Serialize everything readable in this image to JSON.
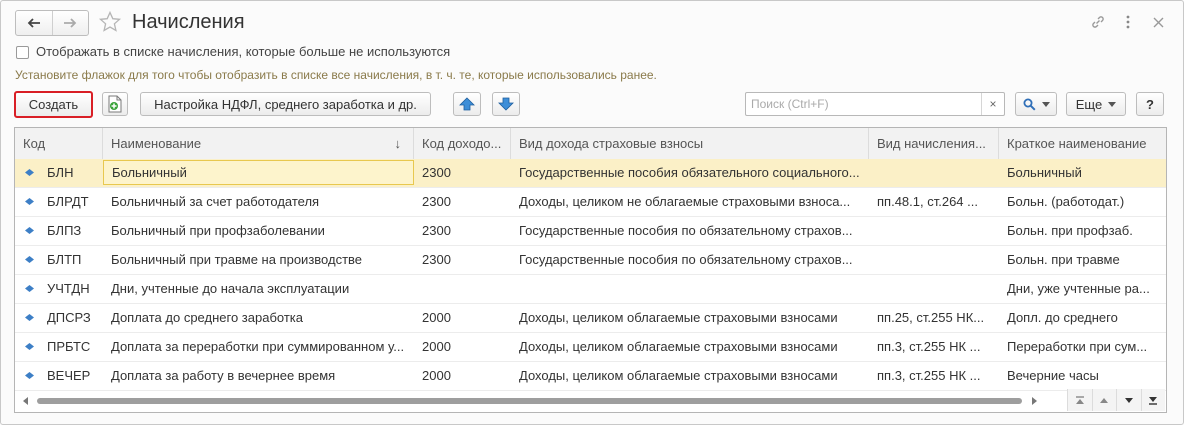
{
  "window": {
    "title": "Начисления"
  },
  "filter": {
    "checkbox_label": "Отображать в списке начисления, которые больше не используются",
    "hint": "Установите флажок для того чтобы отобразить в списке все начисления, в т. ч. те, которые использовались ранее."
  },
  "toolbar": {
    "create_label": "Создать",
    "settings_label": "Настройка НДФЛ, среднего заработка и др.",
    "search_placeholder": "Поиск (Ctrl+F)",
    "search_clear": "×",
    "more_label": "Еще",
    "help_label": "?"
  },
  "table": {
    "columns": [
      "Код",
      "Наименование",
      "Код доходо...",
      "Вид дохода страховые взносы",
      "Вид начисления...",
      "Краткое наименование"
    ],
    "sort_indicator": "↓",
    "rows": [
      [
        "БЛН",
        "Больничный",
        "2300",
        "Государственные пособия обязательного социального...",
        "",
        "Больничный"
      ],
      [
        "БЛРДТ",
        "Больничный за счет работодателя",
        "2300",
        "Доходы, целиком не облагаемые страховыми взноса...",
        "пп.48.1, ст.264 ...",
        "Больн. (работодат.)"
      ],
      [
        "БЛПЗ",
        "Больничный при профзаболевании",
        "2300",
        "Государственные пособия по обязательному страхов...",
        "",
        "Больн. при профзаб."
      ],
      [
        "БЛТП",
        "Больничный при травме на производстве",
        "2300",
        "Государственные пособия по обязательному страхов...",
        "",
        "Больн. при травме"
      ],
      [
        "УЧТДН",
        "Дни, учтенные до начала эксплуатации",
        "",
        "",
        "",
        "Дни, уже учтенные ра..."
      ],
      [
        "ДПСРЗ",
        "Доплата до среднего заработка",
        "2000",
        "Доходы, целиком облагаемые страховыми взносами",
        "пп.25, ст.255 НК...",
        "Допл. до среднего"
      ],
      [
        "ПРБТС",
        "Доплата за переработки при суммированном у...",
        "2000",
        "Доходы, целиком облагаемые страховыми взносами",
        "пп.3, ст.255 НК ...",
        "Переработки при сум..."
      ],
      [
        "ВЕЧЕР",
        "Доплата за работу в вечернее время",
        "2000",
        "Доходы, целиком облагаемые страховыми взносами",
        "пп.3, ст.255 НК ...",
        "Вечерние часы"
      ]
    ]
  },
  "colors": {
    "accent_red": "#d91f26",
    "selected_row": "#fbf0c7",
    "row_icon": "#3d7fc6",
    "hint_text": "#8a7a4a"
  }
}
